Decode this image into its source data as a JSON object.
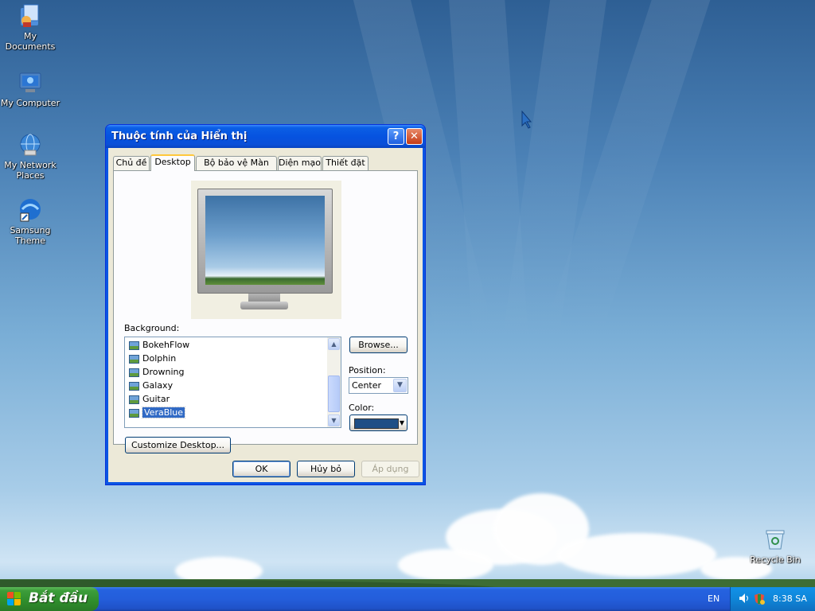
{
  "desktop": {
    "icons": [
      {
        "label": "My Documents"
      },
      {
        "label": "My Computer"
      },
      {
        "label": "My Network Places"
      },
      {
        "label": "Samsung Theme"
      },
      {
        "label": "Recycle Bin"
      }
    ]
  },
  "dialog": {
    "title": "Thuộc tính của Hiển thị",
    "help_glyph": "?",
    "close_glyph": "✕",
    "tabs": [
      {
        "label": "Chủ đề"
      },
      {
        "label": "Desktop"
      },
      {
        "label": "Bộ bảo vệ Màn hình"
      },
      {
        "label": "Diện mạo"
      },
      {
        "label": "Thiết đặt"
      }
    ],
    "active_tab": "Desktop",
    "background_label": "Background:",
    "backgrounds": [
      {
        "name": "BokehFlow"
      },
      {
        "name": "Dolphin"
      },
      {
        "name": "Drowning"
      },
      {
        "name": "Galaxy"
      },
      {
        "name": "Guitar"
      },
      {
        "name": "VeraBlue"
      }
    ],
    "selected_background": "VeraBlue",
    "browse_label": "Browse...",
    "position_label": "Position:",
    "position_value": "Center",
    "color_label": "Color:",
    "color_value": "#1f4f86",
    "customize_label": "Customize Desktop...",
    "ok_label": "OK",
    "cancel_label": "Hủy bỏ",
    "apply_label": "Áp dụng"
  },
  "taskbar": {
    "start_label": "Bắt đầu",
    "language": "EN",
    "time": "8:38 SA"
  }
}
